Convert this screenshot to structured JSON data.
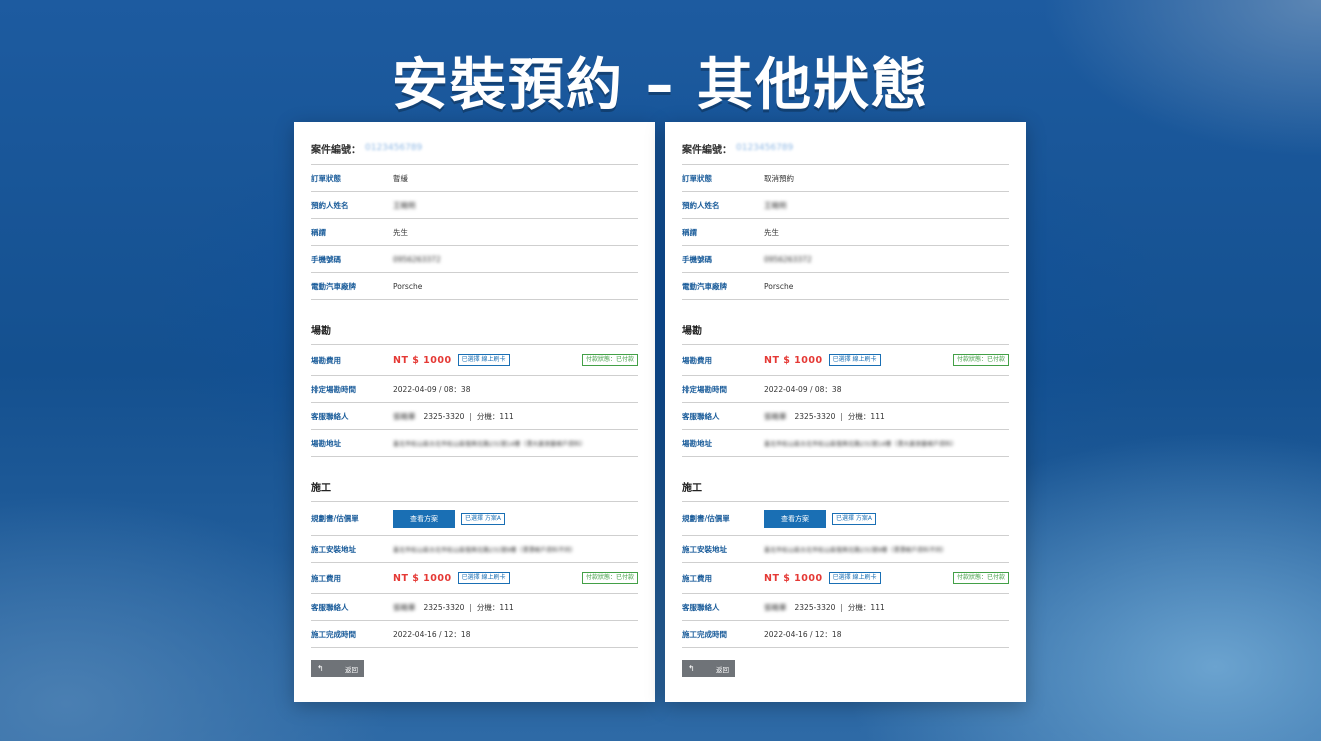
{
  "headline": "安裝預約 – 其他狀態",
  "cards": [
    {
      "case_label": "案件編號：",
      "case_no": "0123456789",
      "order_status_label": "訂單狀態",
      "order_status": "暫緩",
      "name_label": "預約人姓名",
      "name": "王曉明",
      "title_label": "稱謂",
      "title": "先生",
      "phone_label": "手機號碼",
      "phone": "0956263372",
      "brand_label": "電動汽車廠牌",
      "brand": "Porsche",
      "survey": {
        "section_title": "場勘",
        "fee_label": "場勘費用",
        "fee": "NT $ 1000",
        "pay_method": "已選擇 線上刷卡",
        "pay_status": "付款狀態：已付款",
        "time_label": "排定場勘時間",
        "time": "2022-04-09 / 08：38",
        "contact_label": "客服聯絡人",
        "contact_name": "張曉華",
        "contact_phone": "2325-3320",
        "contact_sep": "|",
        "contact_ext": "分機：111",
        "address_label": "場勘地址",
        "address": "臺北市松山區台北市松山區復興北路231號14樓（潭大廈測量帳戶資料）"
      },
      "construction": {
        "section_title": "施工",
        "plan_label": "規劃書/估價單",
        "view_button": "查看方案",
        "plan_selected": "已選擇 方案A",
        "address_label": "施工安裝地址",
        "address": "臺北市松山區台北市松山區復興北路231號9樓（潭潭帳戶資料不同）",
        "fee_label": "施工費用",
        "fee": "NT $ 1000",
        "pay_method": "已選擇 線上刷卡",
        "pay_status": "付款狀態：已付款",
        "contact_label": "客服聯絡人",
        "contact_name": "張曉華",
        "contact_phone": "2325-3320",
        "contact_sep": "|",
        "contact_ext": "分機：111",
        "done_label": "施工完成時間",
        "done_time": "2022-04-16 / 12：18"
      },
      "back_label": "返回"
    },
    {
      "case_label": "案件編號：",
      "case_no": "0123456789",
      "order_status_label": "訂單狀態",
      "order_status": "取消預約",
      "name_label": "預約人姓名",
      "name": "王曉明",
      "title_label": "稱謂",
      "title": "先生",
      "phone_label": "手機號碼",
      "phone": "0956263372",
      "brand_label": "電動汽車廠牌",
      "brand": "Porsche",
      "survey": {
        "section_title": "場勘",
        "fee_label": "場勘費用",
        "fee": "NT $ 1000",
        "pay_method": "已選擇 線上刷卡",
        "pay_status": "付款狀態：已付款",
        "time_label": "排定場勘時間",
        "time": "2022-04-09 / 08：38",
        "contact_label": "客服聯絡人",
        "contact_name": "張曉華",
        "contact_phone": "2325-3320",
        "contact_sep": "|",
        "contact_ext": "分機：111",
        "address_label": "場勘地址",
        "address": "臺北市松山區台北市松山區復興北路231號14樓（潭大廈測量帳戶資料）"
      },
      "construction": {
        "section_title": "施工",
        "plan_label": "規劃書/估價單",
        "view_button": "查看方案",
        "plan_selected": "已選擇 方案A",
        "address_label": "施工安裝地址",
        "address": "臺北市松山區台北市松山區復興北路231號9樓（潭潭帳戶資料不同）",
        "fee_label": "施工費用",
        "fee": "NT $ 1000",
        "pay_method": "已選擇 線上刷卡",
        "pay_status": "付款狀態：已付款",
        "contact_label": "客服聯絡人",
        "contact_name": "張曉華",
        "contact_phone": "2325-3320",
        "contact_sep": "|",
        "contact_ext": "分機：111",
        "done_label": "施工完成時間",
        "done_time": "2022-04-16 / 12：18"
      },
      "back_label": "返回"
    }
  ]
}
